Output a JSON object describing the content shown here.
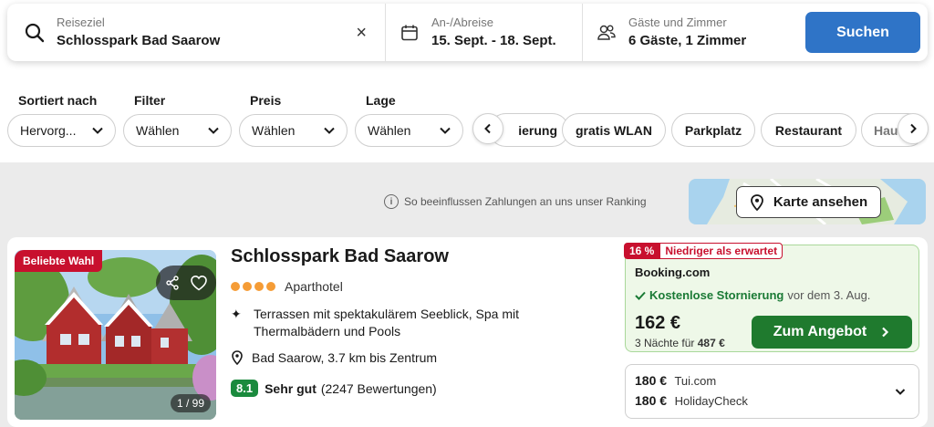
{
  "search": {
    "destination_label": "Reiseziel",
    "destination_value": "Schlosspark Bad Saarow",
    "clear_symbol": "×",
    "dates_label": "An-/Abreise",
    "dates_value": "15. Sept. - 18. Sept.",
    "guests_label": "Gäste und Zimmer",
    "guests_value": "6 Gäste, 1 Zimmer",
    "search_button": "Suchen",
    "button_color": "#2f74c7"
  },
  "filters": {
    "sort": {
      "label": "Sortiert nach",
      "value": "Hervorg..."
    },
    "filter": {
      "label": "Filter",
      "value": "Wählen"
    },
    "price": {
      "label": "Preis",
      "value": "Wählen"
    },
    "location": {
      "label": "Lage",
      "value": "Wählen"
    },
    "chips": [
      "ierung",
      "gratis WLAN",
      "Parkplatz",
      "Restaurant",
      "Hau"
    ]
  },
  "ranking_note": "So beeinflussen Zahlungen an uns unser Ranking",
  "map_button": "Karte ansehen",
  "hotel": {
    "badge": "Beliebte Wahl",
    "photo_count": "1 / 99",
    "name": "Schlosspark Bad Saarow",
    "stars": 4,
    "type": "Aparthotel",
    "feature": "Terrassen mit spektakulärem Seeblick, Spa mit Thermalbädern und Pools",
    "location": "Bad Saarow, 3.7 km bis Zentrum",
    "score": "8.1",
    "score_label": "Sehr gut",
    "reviews": "(2247 Bewertungen)"
  },
  "deal": {
    "discount": "16 %",
    "discount_text": "Niedriger als erwartet",
    "provider": "Booking.com",
    "cancellation": "Kostenlose Stornierung",
    "cancellation_suffix": "vor dem 3. Aug.",
    "price": "162 €",
    "nights_text": "3 Nächte für",
    "total": "487 €",
    "offer_button": "Zum Angebot",
    "button_color": "#1f7a2e"
  },
  "alternatives": [
    {
      "price": "180 €",
      "provider": "Tui.com"
    },
    {
      "price": "180 €",
      "provider": "HolidayCheck"
    }
  ]
}
